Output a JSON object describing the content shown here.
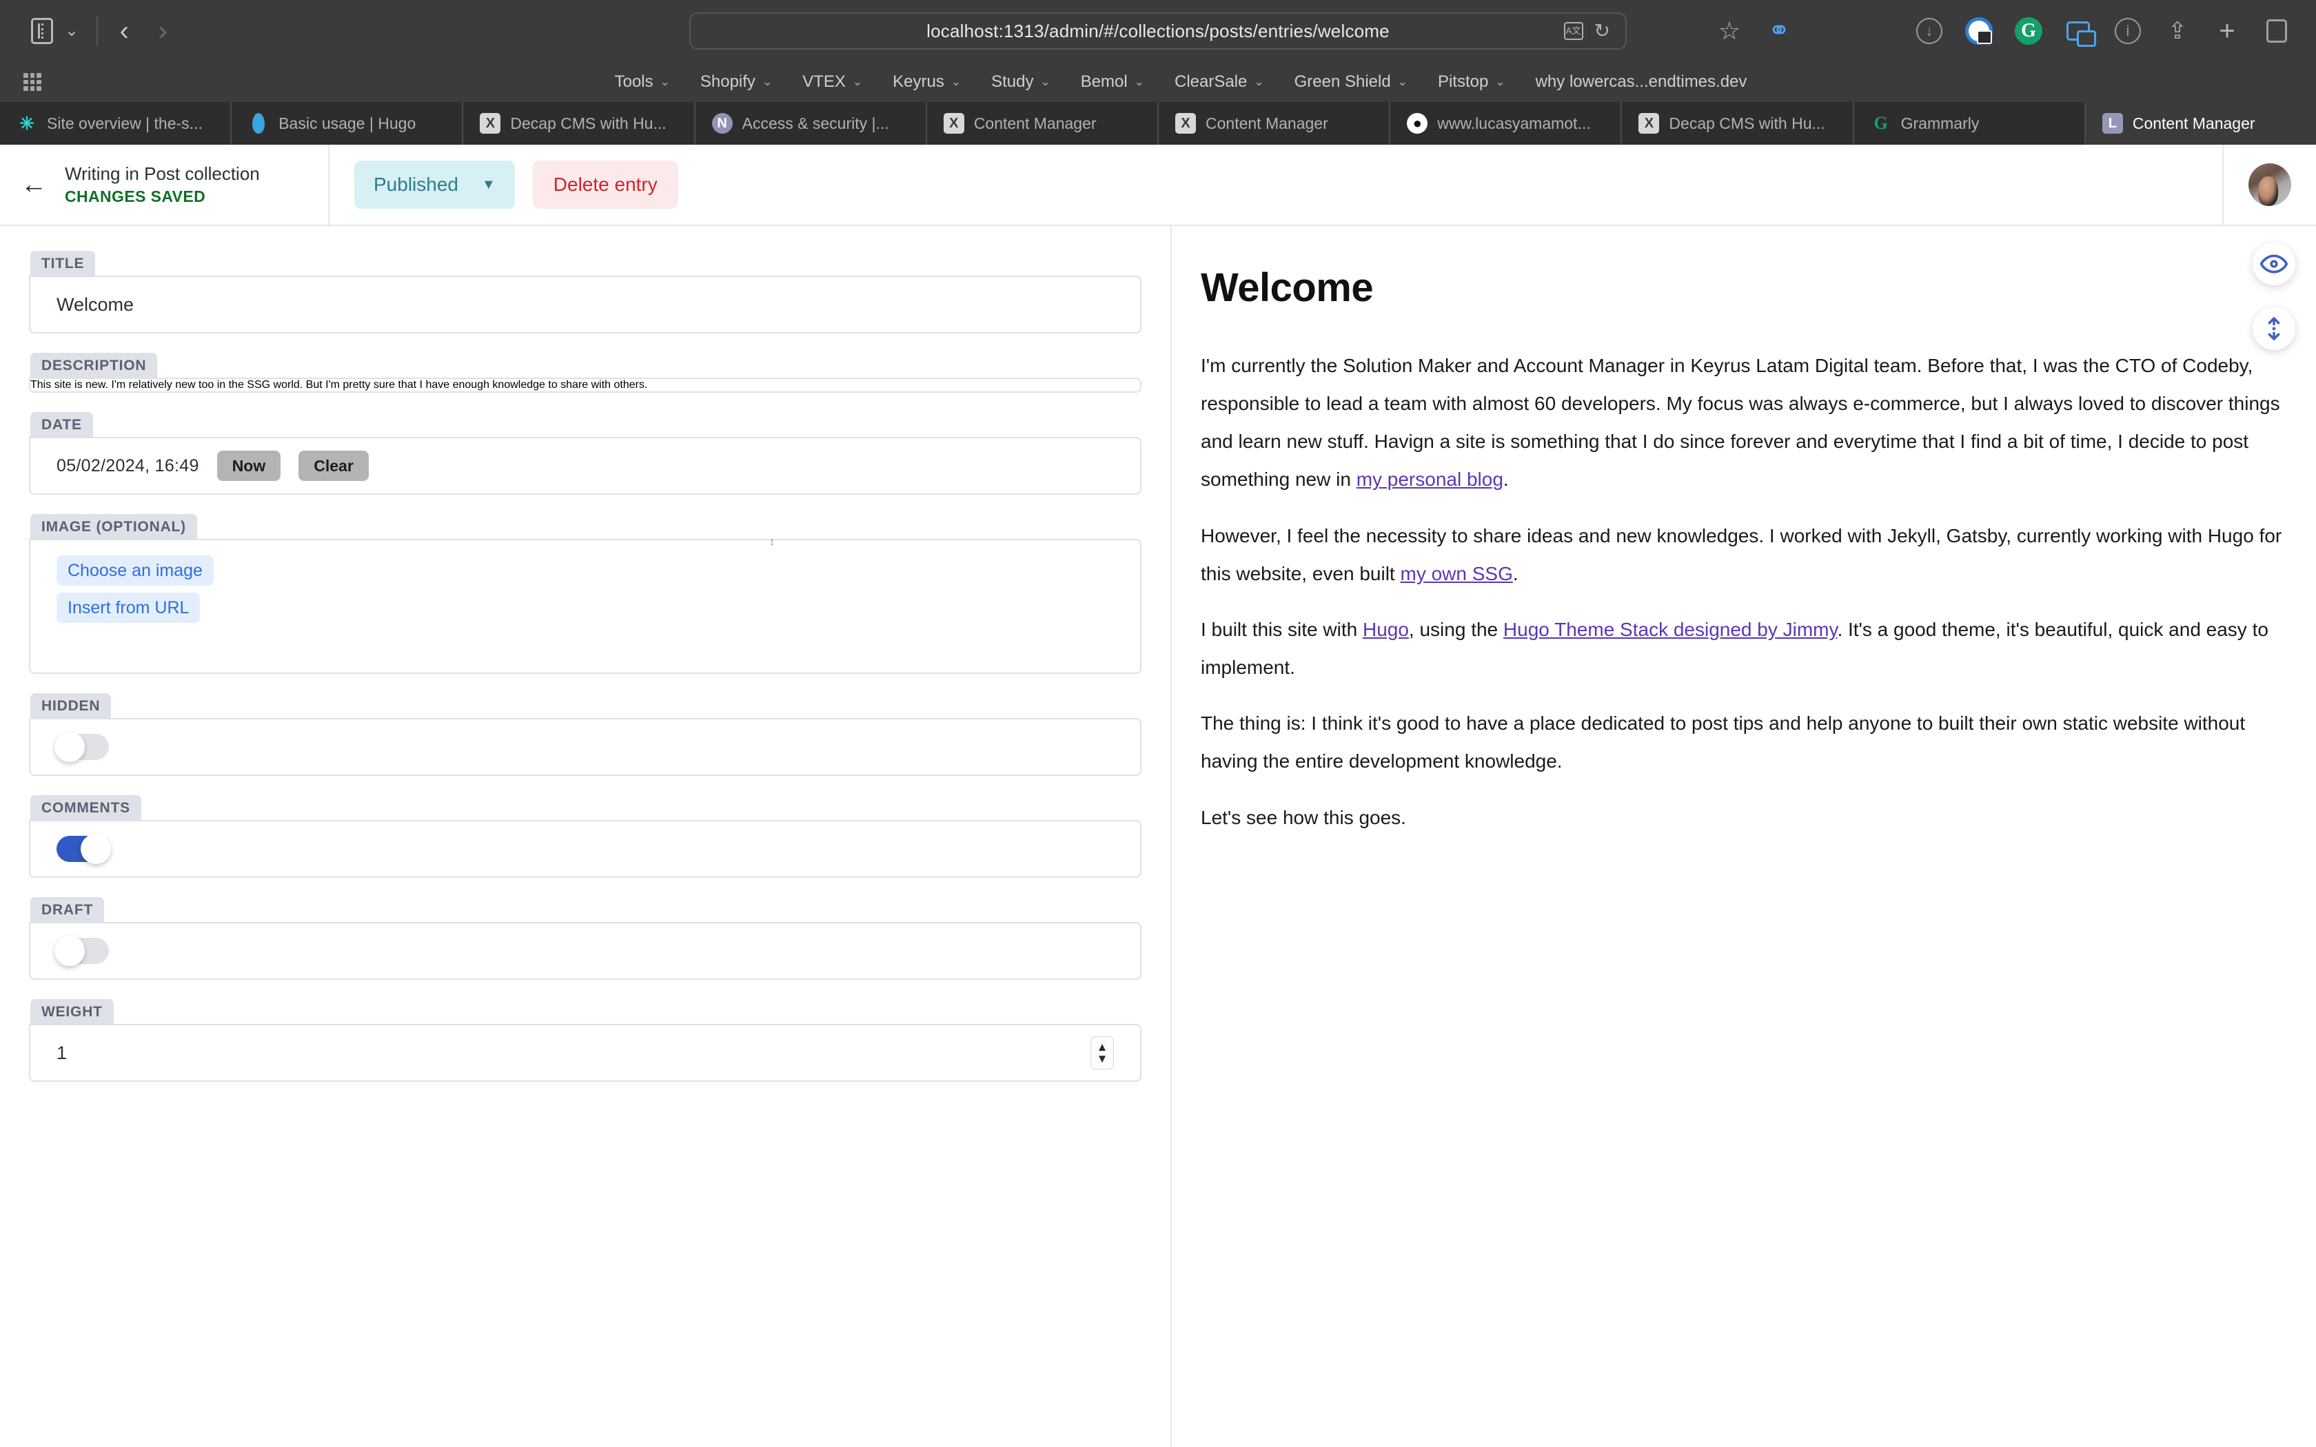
{
  "browser": {
    "url": "localhost:1313/admin/#/collections/posts/entries/welcome",
    "icons": {
      "sidebar": "sidebar-icon",
      "back": "back-arrow-icon",
      "forward": "forward-arrow-icon",
      "translate": "translate-icon",
      "reload": "reload-icon",
      "bookmark_star": "star-icon",
      "shield": "shield-icon",
      "downloads": "downloads-icon",
      "onepassword": "onepassword-icon",
      "grammarly": "grammarly-icon",
      "tab_overview": "tab-overview-icon",
      "info": "info-icon",
      "share": "share-icon",
      "new_tab": "plus-icon",
      "tab_group": "copy-icon",
      "apps_grid": "grid-icon"
    },
    "bookmarks": [
      {
        "label": "Tools",
        "caret": "⌄"
      },
      {
        "label": "Shopify",
        "caret": "⌄"
      },
      {
        "label": "VTEX",
        "caret": "⌄"
      },
      {
        "label": "Keyrus",
        "caret": "⌄"
      },
      {
        "label": "Study",
        "caret": "⌄"
      },
      {
        "label": "Bemol",
        "caret": "⌄"
      },
      {
        "label": "ClearSale",
        "caret": "⌄"
      },
      {
        "label": "Green Shield",
        "caret": "⌄"
      },
      {
        "label": "Pitstop",
        "caret": "⌄"
      },
      {
        "label": "why lowercas...endtimes.dev",
        "caret": ""
      }
    ],
    "tabs": [
      {
        "label": "Site overview | the-s...",
        "favicon": "netlify-site-icon",
        "active": false
      },
      {
        "label": "Basic usage | Hugo",
        "favicon": "hugo-icon",
        "active": false
      },
      {
        "label": "Decap CMS with Hu...",
        "favicon": "x-icon",
        "active": false
      },
      {
        "label": "Access & security |...",
        "favicon": "netlify-icon",
        "active": false
      },
      {
        "label": "Content Manager",
        "favicon": "x-icon",
        "active": false
      },
      {
        "label": "Content Manager",
        "favicon": "x-icon",
        "active": false
      },
      {
        "label": "www.lucasyamamot...",
        "favicon": "github-icon",
        "active": false
      },
      {
        "label": "Decap CMS with Hu...",
        "favicon": "x-icon",
        "active": false
      },
      {
        "label": "Grammarly",
        "favicon": "grammarly-icon",
        "active": false
      },
      {
        "label": "Content Manager",
        "favicon": "decap-icon",
        "active": true
      }
    ]
  },
  "app_header": {
    "back_icon": "back-arrow-icon",
    "title": "Writing in Post collection",
    "status": "CHANGES SAVED",
    "published_label": "Published",
    "published_caret": "▼",
    "delete_label": "Delete entry",
    "avatar": "user-avatar"
  },
  "editor": {
    "fields": [
      {
        "key": "title",
        "label": "TITLE",
        "type": "text",
        "value": "Welcome"
      },
      {
        "key": "description",
        "label": "DESCRIPTION",
        "type": "textarea",
        "value": "This site is new. I'm relatively new too in the SSG world. But I'm pretty sure that I have enough knowledge to share with others."
      },
      {
        "key": "date",
        "label": "DATE",
        "type": "date",
        "value": "05/02/2024, 16:49",
        "now_label": "Now",
        "clear_label": "Clear"
      },
      {
        "key": "image",
        "label": "IMAGE (OPTIONAL)",
        "type": "image",
        "choose_label": "Choose an image",
        "url_label": "Insert from URL"
      },
      {
        "key": "hidden",
        "label": "HIDDEN",
        "type": "toggle",
        "value": false
      },
      {
        "key": "comments",
        "label": "COMMENTS",
        "type": "toggle",
        "value": true
      },
      {
        "key": "draft",
        "label": "DRAFT",
        "type": "toggle",
        "value": false
      },
      {
        "key": "weight",
        "label": "WEIGHT",
        "type": "number",
        "value": "1"
      }
    ]
  },
  "preview": {
    "title": "Welcome",
    "eye_icon": "eye-icon",
    "scroll_sync_icon": "scroll-sync-icon",
    "paragraphs": [
      {
        "parts": [
          {
            "t": "I'm currently the Solution Maker and Account Manager in Keyrus Latam Digital team. Before that, I was the CTO of Codeby, responsible to lead a team with almost 60 developers. My focus was always e-commerce, but I always loved to discover things and learn new stuff. Havign a site is something that I do since forever and everytime that I find a bit of time, I decide to post something new in "
          },
          {
            "t": "my personal blog",
            "link": true
          },
          {
            "t": "."
          }
        ]
      },
      {
        "parts": [
          {
            "t": "However, I feel the necessity to share ideas and new knowledges. I worked with Jekyll, Gatsby, currently working with Hugo for this website, even built "
          },
          {
            "t": "my own SSG",
            "link": true
          },
          {
            "t": "."
          }
        ]
      },
      {
        "parts": [
          {
            "t": "I built this site with "
          },
          {
            "t": "Hugo",
            "link": true
          },
          {
            "t": ", using the "
          },
          {
            "t": "Hugo Theme Stack designed by Jimmy",
            "link": true
          },
          {
            "t": ". It's a good theme, it's beautiful, quick and easy to implement."
          }
        ]
      },
      {
        "parts": [
          {
            "t": "The thing is: I think it's good to have a place dedicated to post tips and help anyone to built their own static website without having the entire development knowledge."
          }
        ]
      },
      {
        "parts": [
          {
            "t": "Let's see how this goes."
          }
        ]
      }
    ]
  },
  "colors": {
    "published_bg": "#d7f0f4",
    "published_fg": "#2e7d8c",
    "delete_bg": "#fbeae9",
    "delete_fg": "#cf2233",
    "saved_fg": "#126e25",
    "toggle_on": "#3259c4",
    "link": "#5b36b6",
    "accent_blue": "#2f6fdd",
    "field_label_bg": "#dfe1e8"
  }
}
